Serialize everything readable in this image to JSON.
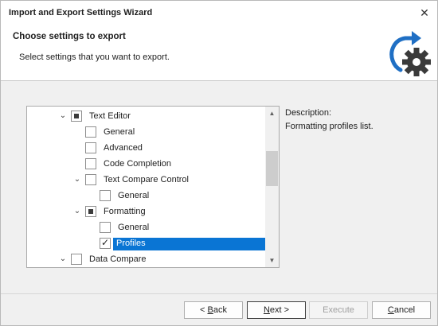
{
  "window": {
    "title": "Import and Export Settings Wizard",
    "close_glyph": "✕"
  },
  "header": {
    "title": "Choose settings to export",
    "description": "Select settings that you want to export.",
    "icon": "export-settings-gear-icon",
    "icon_colors": {
      "arrow": "#1f6fc4",
      "gear": "#3a3a3a"
    }
  },
  "tree": {
    "items": [
      {
        "label": "Text Editor",
        "expander": "⌄",
        "state": "partial"
      },
      {
        "label": "General",
        "state": "unchecked"
      },
      {
        "label": "Advanced",
        "state": "unchecked"
      },
      {
        "label": "Code Completion",
        "state": "unchecked"
      },
      {
        "label": "Text Compare Control",
        "expander": "⌄",
        "state": "unchecked"
      },
      {
        "label": "General",
        "state": "unchecked"
      },
      {
        "label": "Formatting",
        "expander": "⌄",
        "state": "partial"
      },
      {
        "label": "General",
        "state": "unchecked"
      },
      {
        "label": "Profiles",
        "state": "checked",
        "selected": true
      },
      {
        "label": "Data Compare",
        "expander": "⌄",
        "state": "unchecked"
      }
    ],
    "scroll_up_glyph": "▲",
    "scroll_down_glyph": "▼",
    "selection_color": "#0a75d4"
  },
  "description": {
    "label": "Description:",
    "text": "Formatting profiles list."
  },
  "buttons": {
    "back": {
      "prefix": "< ",
      "mnemonic": "B",
      "rest": "ack"
    },
    "next": {
      "mnemonic": "N",
      "rest": "ext >"
    },
    "execute": {
      "label": "Execute"
    },
    "cancel": {
      "mnemonic": "C",
      "rest": "ancel"
    }
  }
}
